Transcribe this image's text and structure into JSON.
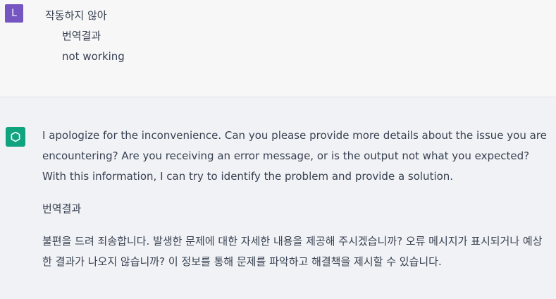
{
  "user": {
    "avatar_letter": "L",
    "message": "작동하지 않아",
    "translation_label": "번역결과",
    "translation": "not working"
  },
  "assistant": {
    "paragraph1": "I apologize for the inconvenience. Can you please provide more details about the issue you are encountering? Are you receiving an error message, or is the output not what you expected? With this information, I can try to identify the problem and provide a solution.",
    "translation_label": "번역결과",
    "paragraph2": "불편을 드려 죄송합니다. 발생한 문제에 대한 자세한 내용을 제공해 주시겠습니까? 오류 메시지가 표시되거나 예상한 결과가 나오지 않습니까? 이 정보를 통해 문제를 파악하고 해결책을 제시할 수 있습니다."
  },
  "colors": {
    "user_avatar": "#7555c2",
    "assistant_avatar": "#10a37f",
    "user_bg": "#f7f7f8",
    "assistant_bg": "#f1f2f5"
  },
  "icons": {
    "assistant_avatar": "openai-logo-icon"
  }
}
